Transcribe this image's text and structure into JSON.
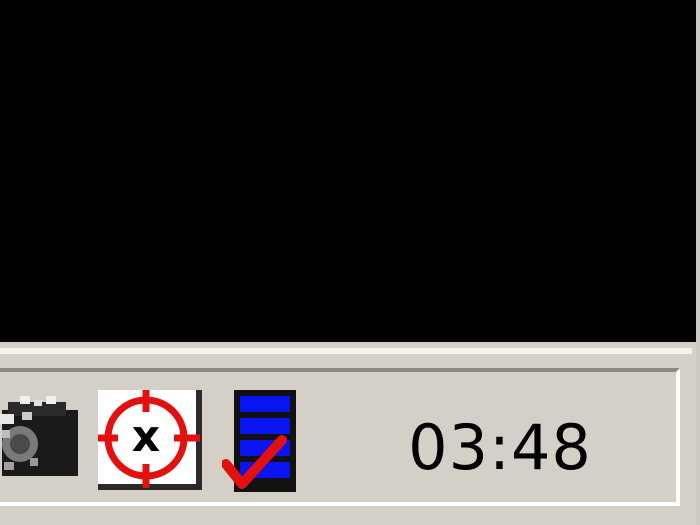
{
  "taskbar": {
    "tray": {
      "icons": [
        {
          "name": "network-printer-icon"
        },
        {
          "name": "target-crosshair-icon",
          "glyph": "x",
          "ring_color": "#e31010"
        },
        {
          "name": "server-check-icon",
          "bar_color": "#0a14f0",
          "check_color": "#e31010"
        }
      ],
      "clock": "03:48"
    }
  },
  "colors": {
    "desktop": "#000000",
    "taskbar": "#d4d0c8"
  }
}
